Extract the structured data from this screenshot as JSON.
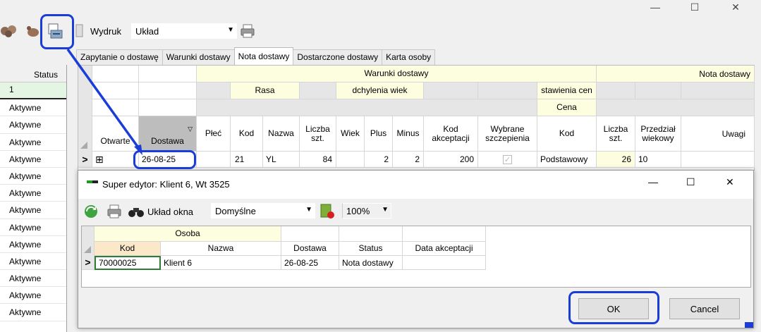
{
  "window": {
    "controls": {
      "minimize": "—",
      "maximize": "☐",
      "close": "✕"
    }
  },
  "toolbar": {
    "print_label": "Wydruk",
    "layout_value": "Układ"
  },
  "left_column": {
    "header": "Status",
    "first_value": "1",
    "rows": [
      "Aktywne",
      "Aktywne",
      "Aktywne",
      "Aktywne",
      "Aktywne",
      "Aktywne",
      "Aktywne",
      "Aktywne",
      "Aktywne",
      "Aktywne",
      "Aktywne",
      "Aktywne",
      "Aktywne"
    ]
  },
  "tabs": [
    "Zapytanie o dostawę",
    "Warunki dostawy",
    "Nota dostawy",
    "Dostarczone dostawy",
    "Karta osoby"
  ],
  "grid": {
    "group_warunki": "Warunki dostawy",
    "group_nota": "Nota dostawy",
    "sub_rasa": "Rasa",
    "sub_odchylenia": "dchylenia wiek",
    "sub_ustawienia": "stawienia cen",
    "sub_cena": "Cena",
    "columns": {
      "otwarte": "Otwarte",
      "dostawa": "Dostawa",
      "plec": "Płeć",
      "kod": "Kod",
      "nazwa": "Nazwa",
      "liczba_szt": "Liczba szt.",
      "wiek": "Wiek",
      "plus": "Plus",
      "minus": "Minus",
      "kod_akceptacji": "Kod akceptacji",
      "wybrane_szczepienia": "Wybrane szczepienia",
      "kod2": "Kod",
      "liczba_szt2": "Liczba szt.",
      "przedzial_wiekowy": "Przedział wiekowy",
      "uwagi": "Uwagi"
    },
    "row": {
      "indicator": ">",
      "expand": "⊞",
      "dostawa": "26-08-25",
      "kod": "21",
      "nazwa": "YL",
      "liczba": "84",
      "plus": "2",
      "minus": "2",
      "kod_akceptacji": "200",
      "kod2": "Podstawowy",
      "liczba2": "26",
      "przedzial": "10"
    }
  },
  "dialog": {
    "title": "Super edytor: Klient 6, Wt 3525",
    "layout_label": "Układ okna",
    "layout_value": "Domyślne",
    "zoom": "100%",
    "grid": {
      "group_osoba": "Osoba",
      "columns": [
        "Kod",
        "Nazwa",
        "Dostawa",
        "Status",
        "Data akceptacji"
      ],
      "row": {
        "indicator": ">",
        "kod": "70000025",
        "nazwa": "Klient 6",
        "dostawa": "26-08-25",
        "status": "Nota dostawy",
        "data": ""
      }
    },
    "ok_label": "OK",
    "cancel_label": "Cancel"
  },
  "colors": {
    "highlight": "#1a3dd8",
    "header_yellow": "#fdfde0",
    "header_orange": "#fbe8c8",
    "selected_green": "#e4f5e4"
  }
}
